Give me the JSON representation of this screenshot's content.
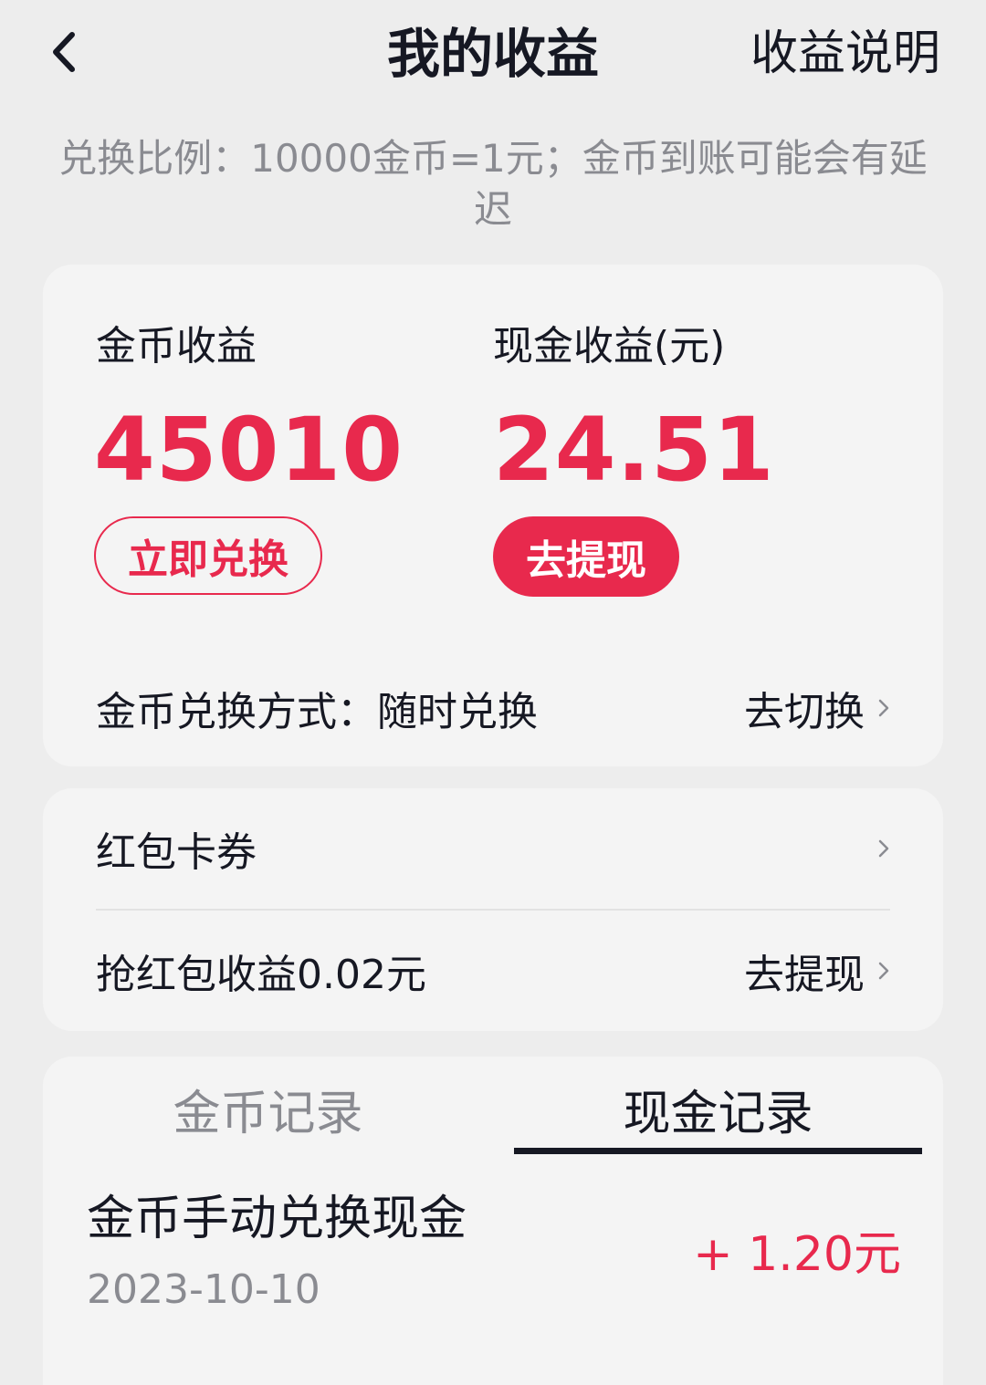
{
  "header": {
    "title": "我的收益",
    "help_link": "收益说明"
  },
  "exchange_note": "兑换比例：10000金币=1元；金币到账可能会有延迟",
  "earnings": {
    "coin_label": "金币收益",
    "coin_value": "45010",
    "coin_button": "立即兑换",
    "cash_label": "现金收益(元)",
    "cash_value": "24.51",
    "cash_button": "去提现",
    "exchange_mode_label": "金币兑换方式：随时兑换",
    "exchange_mode_action": "去切换"
  },
  "list": {
    "coupons_label": "红包卡券",
    "red_packet_label": "抢红包收益0.02元",
    "red_packet_action": "去提现"
  },
  "records": {
    "tabs": [
      "金币记录",
      "现金记录"
    ],
    "active_tab": "现金记录",
    "items": [
      {
        "title": "金币手动兑换现金",
        "date": "2023-10-10",
        "amount": "+ 1.20元"
      }
    ]
  },
  "colors": {
    "accent": "#e8294d",
    "background": "#ededed",
    "card": "#f4f4f4",
    "text_primary": "#161823",
    "text_secondary": "#8a8b91"
  },
  "icons": {
    "back": "chevron-left-icon",
    "row_arrow": "chevron-right-icon"
  }
}
